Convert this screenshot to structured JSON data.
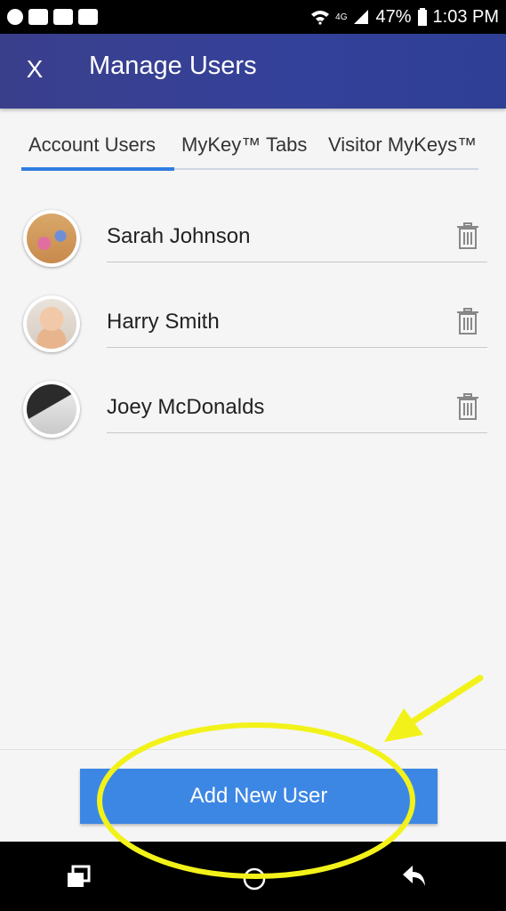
{
  "status_bar": {
    "battery": "47%",
    "time": "1:03 PM",
    "network": "4G"
  },
  "app_bar": {
    "close_label": "X",
    "title": "Manage Users"
  },
  "tabs": [
    {
      "label": "Account Users",
      "active": true
    },
    {
      "label": "MyKey™ Tabs",
      "active": false
    },
    {
      "label": "Visitor MyKeys™",
      "active": false
    }
  ],
  "users": [
    {
      "name": "Sarah Johnson",
      "avatar": "photo-kids-outdoors"
    },
    {
      "name": "Harry Smith",
      "avatar": "photo-baby"
    },
    {
      "name": "Joey McDonalds",
      "avatar": "photo-calculator"
    }
  ],
  "actions": {
    "add_user_label": "Add New User"
  },
  "colors": {
    "app_bar": "#34419a",
    "accent": "#2f7de1",
    "button": "#3d87e4",
    "annotation": "#f2f21a"
  }
}
